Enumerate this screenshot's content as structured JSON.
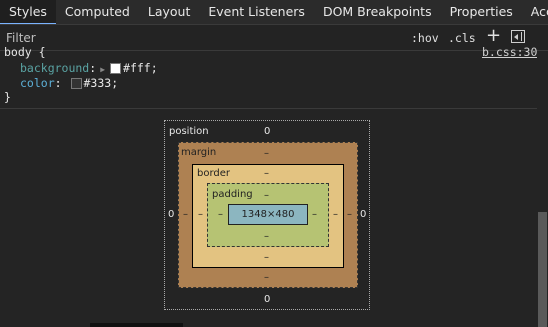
{
  "tabs": [
    "Styles",
    "Computed",
    "Layout",
    "Event Listeners",
    "DOM Breakpoints",
    "Properties",
    "Accessibility"
  ],
  "toolbar": {
    "filter_placeholder": "Filter",
    "hov": ":hov",
    "cls": ".cls",
    "add": "+"
  },
  "rule": {
    "selector": "body {",
    "source": "b.css:30",
    "declarations": [
      {
        "property": "background",
        "value": "#fff",
        "swatch": "#ffffff",
        "overridden": true
      },
      {
        "property": "color",
        "value": "#333",
        "swatch": "#333333",
        "overridden": false
      }
    ],
    "close": "}"
  },
  "box_model": {
    "position_label": "position",
    "position_top": "0",
    "position_bottom": "0",
    "position_left": "0",
    "position_right": "0",
    "margin_label": "margin",
    "margin_top": "–",
    "margin_bottom": "–",
    "margin_left": "–",
    "margin_right": "–",
    "border_label": "border",
    "border_top": "–",
    "border_bottom": "–",
    "border_left": "–",
    "border_right": "–",
    "padding_label": "padding",
    "padding_top": "–",
    "padding_bottom": "–",
    "padding_left": "–",
    "padding_right": "–",
    "content": "1348×480"
  }
}
